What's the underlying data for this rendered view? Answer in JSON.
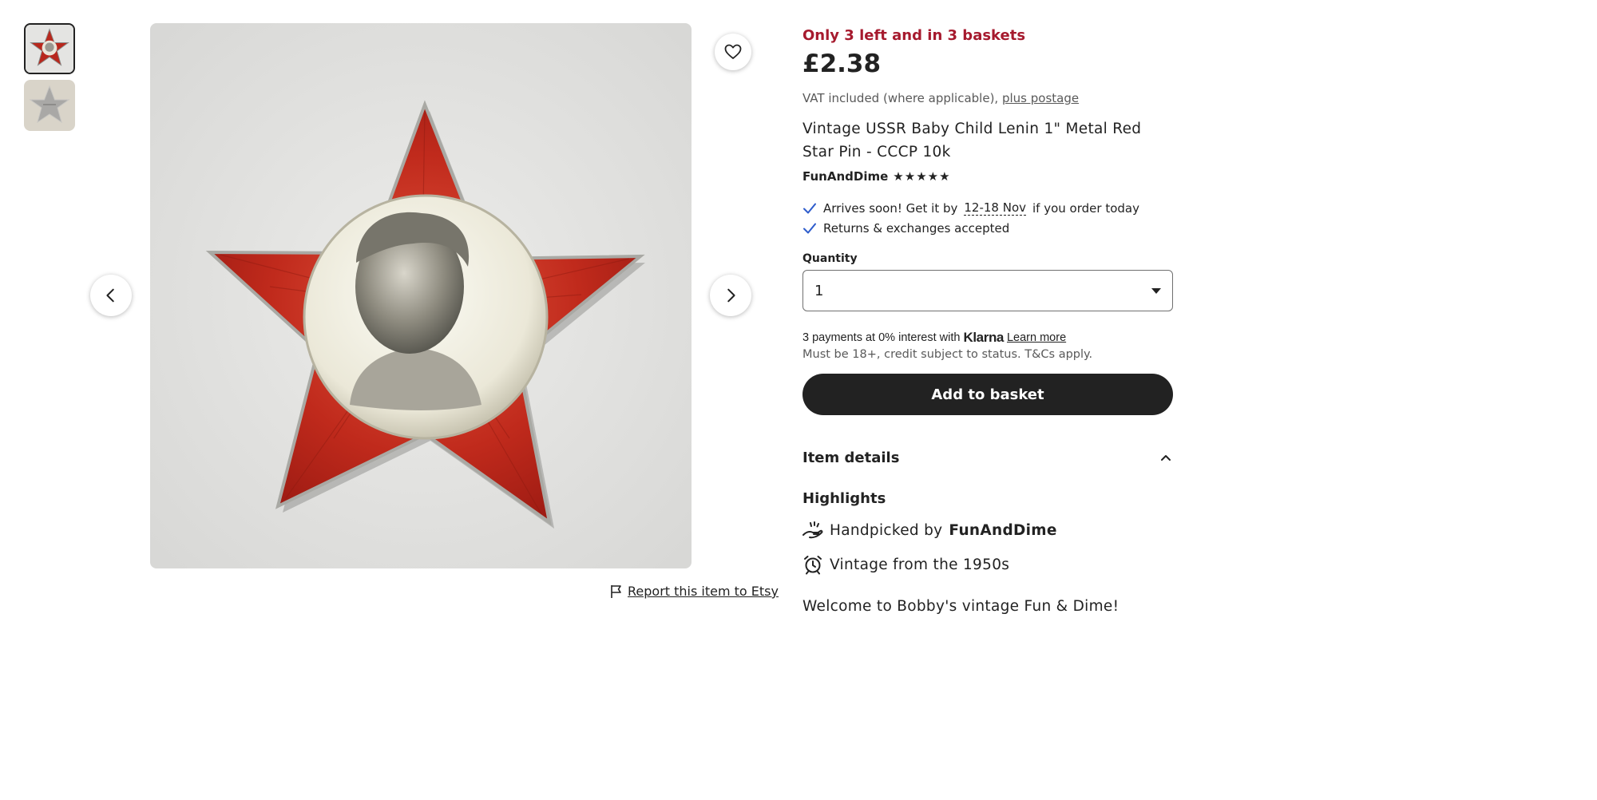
{
  "colors": {
    "stock_red": "#a61a2e",
    "text": "#222222",
    "muted": "#595959",
    "button_dark": "#222222",
    "check_blue": "#2f5dcc"
  },
  "gallery": {
    "thumbnails": [
      {
        "alt": "star-pin-front-thumbnail",
        "selected": true
      },
      {
        "alt": "star-pin-back-thumbnail",
        "selected": false
      }
    ],
    "icons": {
      "prev": "chevron-left-icon",
      "next": "chevron-right-icon",
      "favorite": "heart-icon",
      "report": "flag-icon"
    },
    "report_label": "Report this item to Etsy"
  },
  "listing": {
    "stock_text": "Only 3 left and in 3 baskets",
    "price": "£2.38",
    "vat_text": "VAT included (where applicable),",
    "postage_link": "plus postage",
    "title": "Vintage USSR Baby Child Lenin 1\" Metal Red Star Pin - CCCP 10k",
    "shop_name": "FunAndDime",
    "rating_stars": 5,
    "stars": [
      "★",
      "★",
      "★",
      "★",
      "★"
    ]
  },
  "delivery": {
    "arrives_prefix": "Arrives soon! Get it by",
    "arrives_dates": "12-18 Nov",
    "arrives_suffix": "if you order today",
    "returns": "Returns & exchanges accepted"
  },
  "quantity": {
    "label": "Quantity",
    "selected": "1"
  },
  "klarna": {
    "prefix": "3 payments at 0% interest with",
    "logo": "Klarna",
    "learn_more": "Learn more",
    "terms": "Must be 18+, credit subject to status. T&Cs apply."
  },
  "actions": {
    "add_to_basket": "Add to basket"
  },
  "details": {
    "item_details_label": "Item details",
    "highlights_label": "Highlights",
    "handpicked_prefix": "Handpicked by",
    "handpicked_shop": "FunAndDime",
    "vintage": "Vintage from the 1950s",
    "welcome": "Welcome to Bobby's vintage Fun & Dime!"
  }
}
